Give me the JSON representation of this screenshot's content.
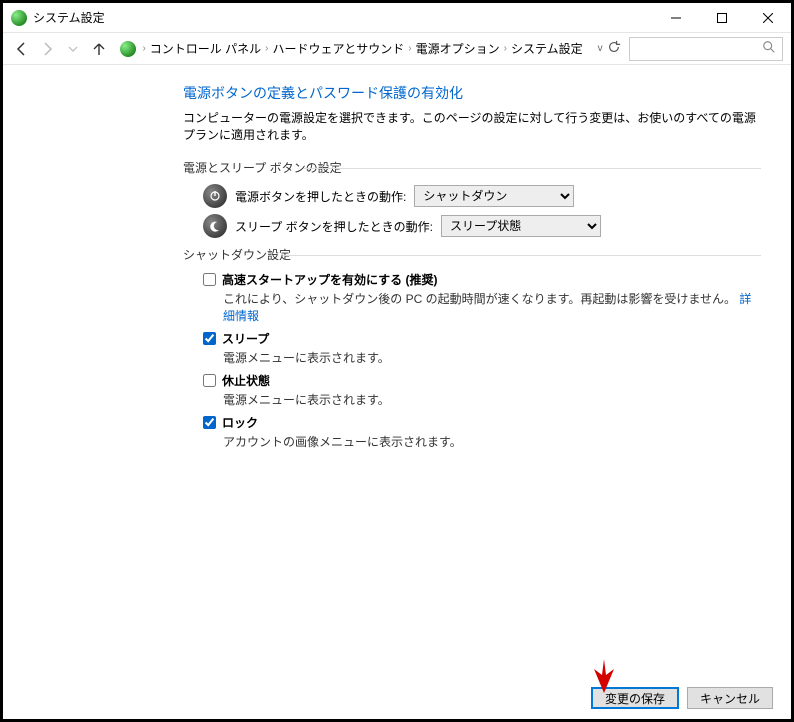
{
  "titlebar": {
    "title": "システム設定"
  },
  "breadcrumb": {
    "items": [
      "コントロール パネル",
      "ハードウェアとサウンド",
      "電源オプション",
      "システム設定"
    ]
  },
  "page": {
    "title": "電源ボタンの定義とパスワード保護の有効化",
    "description": "コンピューターの電源設定を選択できます。このページの設定に対して行う変更は、お使いのすべての電源プランに適用されます。"
  },
  "button_group": {
    "label": "電源とスリープ ボタンの設定",
    "rows": [
      {
        "label": "電源ボタンを押したときの動作:",
        "value": "シャットダウン"
      },
      {
        "label": "スリープ ボタンを押したときの動作:",
        "value": "スリープ状態"
      }
    ]
  },
  "shutdown_group": {
    "label": "シャットダウン設定",
    "items": [
      {
        "checked": false,
        "label": "高速スタートアップを有効にする (推奨)",
        "desc": "これにより、シャットダウン後の PC の起動時間が速くなります。再起動は影響を受けません。",
        "link": "詳細情報"
      },
      {
        "checked": true,
        "label": "スリープ",
        "desc": "電源メニューに表示されます。"
      },
      {
        "checked": false,
        "label": "休止状態",
        "desc": "電源メニューに表示されます。"
      },
      {
        "checked": true,
        "label": "ロック",
        "desc": "アカウントの画像メニューに表示されます。"
      }
    ]
  },
  "footer": {
    "save": "変更の保存",
    "cancel": "キャンセル"
  }
}
